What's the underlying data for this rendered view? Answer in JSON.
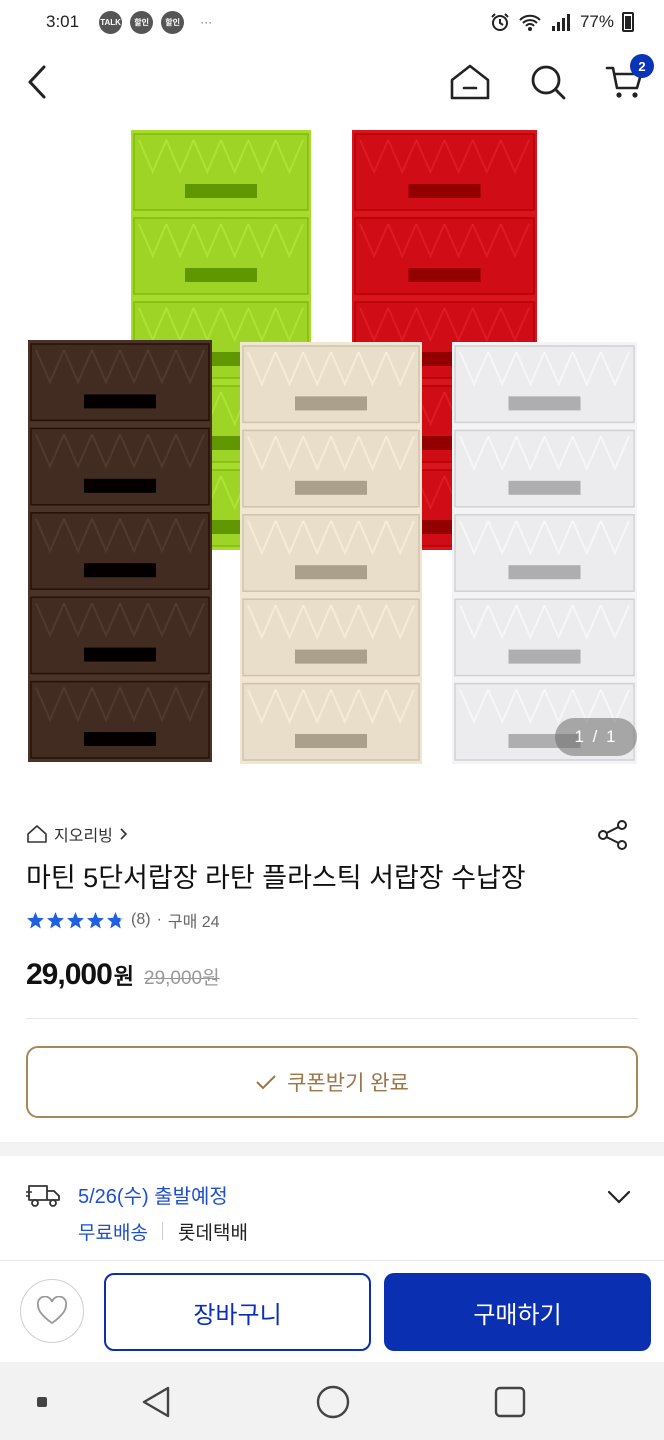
{
  "status_bar": {
    "time": "3:01",
    "icons": [
      "talk-icon",
      "sale-icon",
      "sale-icon"
    ],
    "pill_labels": [
      "TALK",
      "할인",
      "할인"
    ],
    "more": "···",
    "battery": "77%"
  },
  "header": {
    "cart_count": "2"
  },
  "product": {
    "image_counter": "1 / 1",
    "drawer_colors": [
      "#a6dc2e",
      "#d8141e",
      "#4a3328",
      "#f1e6d2",
      "#f4f4f6"
    ],
    "seller": "지오리빙",
    "title": "마틴 5단서랍장 라탄 플라스틱 서랍장 수납장",
    "rating_value": 4.8,
    "review_count": "(8)",
    "separator": "·",
    "purchase": "구매 24",
    "price": "29,000",
    "price_unit": "원",
    "original_price": "29,000원",
    "coupon_label": "쿠폰받기 완료"
  },
  "shipping": {
    "date": "5/26(수) 출발예정",
    "free": "무료배송",
    "carrier": "롯데택배"
  },
  "actions": {
    "cart": "장바구니",
    "buy": "구매하기"
  },
  "colors": {
    "brand_blue": "#0a2fb0",
    "link_blue": "#1f4fd1",
    "coupon_gold": "#9a7648"
  }
}
